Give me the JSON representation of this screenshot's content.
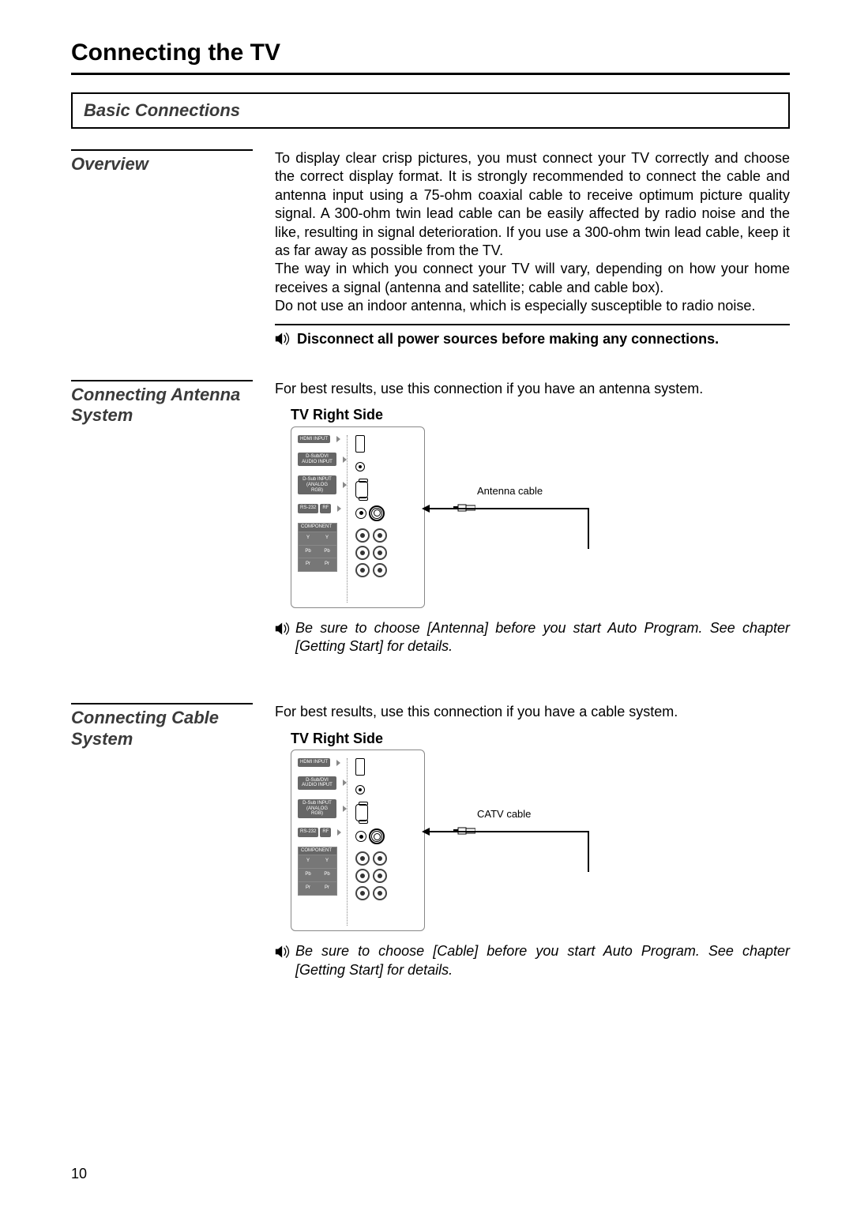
{
  "page": {
    "title": "Connecting the TV",
    "number": "10"
  },
  "basic": {
    "heading": "Basic Connections"
  },
  "overview": {
    "heading": "Overview",
    "para1": "To display clear crisp pictures, you must connect your TV correctly and choose the correct display format. It is strongly recommended to connect the cable and antenna input using a 75-ohm coaxial cable to receive optimum picture quality signal. A 300-ohm twin lead cable can be easily affected by radio noise and the like, resulting in signal deterioration. If you use a 300-ohm twin lead cable, keep it as far away as possible from the TV.",
    "para2": "The way in which you connect your TV will vary, depending on how your home receives a signal (antenna and satellite; cable and cable box).",
    "para3": "Do not use an indoor antenna, which is especially susceptible to radio noise.",
    "disconnect": "Disconnect all power sources before making any connections."
  },
  "antenna": {
    "heading": "Connecting Antenna System",
    "intro": "For best results, use this connection if you have an antenna system.",
    "tv_side": "TV Right Side",
    "cable_label": "Antenna cable",
    "note": "Be sure to choose [Antenna] before you start Auto Program. See chapter [Getting Start] for details."
  },
  "cable": {
    "heading": "Connecting Cable System",
    "intro": "For best results, use this connection if you have a cable system.",
    "tv_side": "TV Right Side",
    "cable_label": "CATV cable",
    "note": "Be sure to choose [Cable] before you start Auto Program. See chapter [Getting Start] for details."
  },
  "ports": {
    "hdmi": "HDMI INPUT",
    "dsub_audio": "D-Sub/DVI AUDIO INPUT",
    "dsub_input": "D-Sub INPUT (ANALOG RGB)",
    "rs232": "RS-232",
    "rf": "RF",
    "component": "COMPONENT",
    "y": "Y",
    "pb": "Pb",
    "pr": "Pr"
  }
}
